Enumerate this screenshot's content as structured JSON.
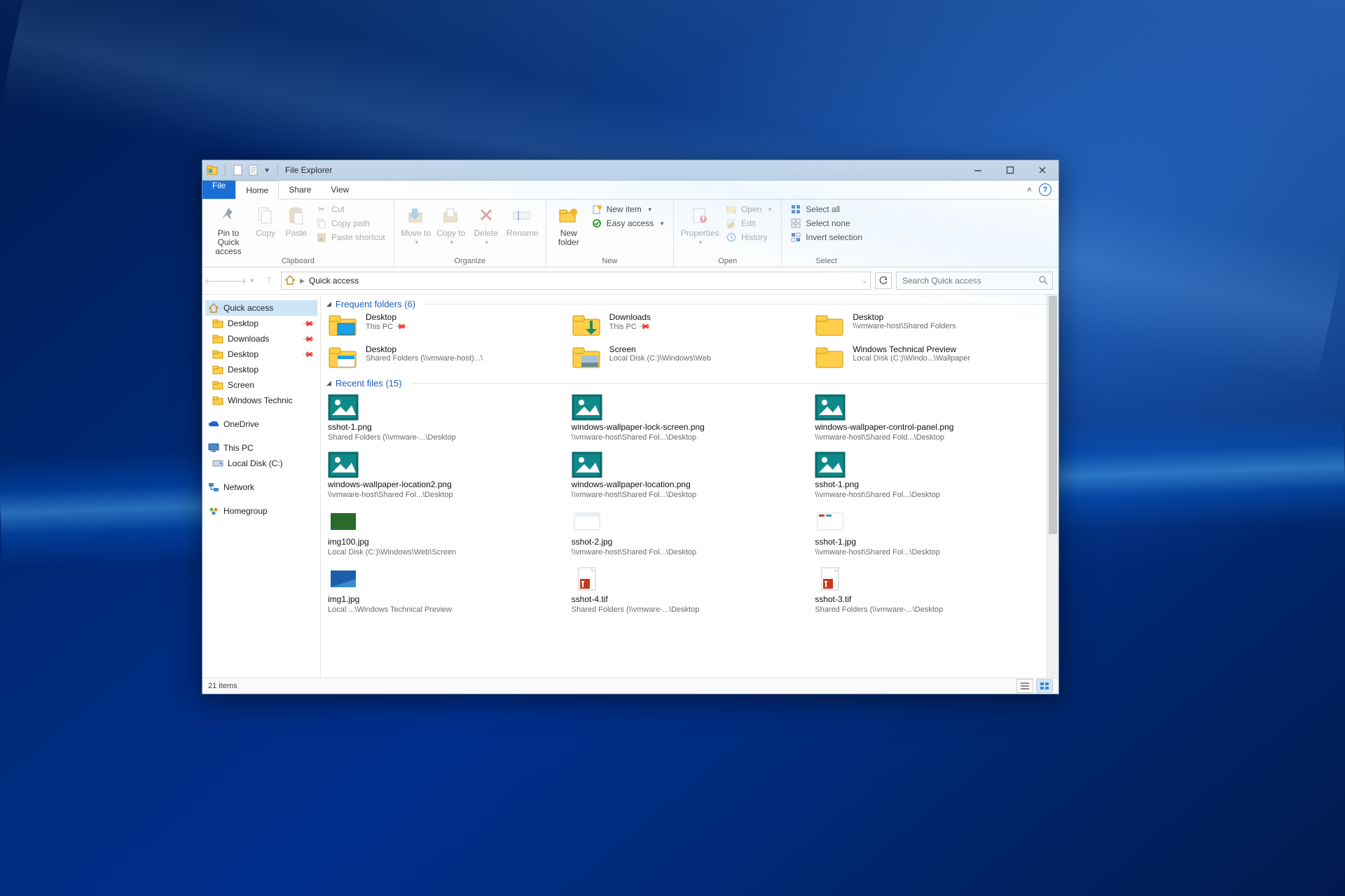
{
  "window": {
    "title": "File Explorer"
  },
  "tabs": {
    "file": "File",
    "home": "Home",
    "share": "Share",
    "view": "View"
  },
  "ribbon": {
    "clipboard": {
      "label": "Clipboard",
      "pin": "Pin to Quick access",
      "copy": "Copy",
      "paste": "Paste",
      "cut": "Cut",
      "copy_path": "Copy path",
      "paste_shortcut": "Paste shortcut"
    },
    "organize": {
      "label": "Organize",
      "move_to": "Move to",
      "copy_to": "Copy to",
      "delete": "Delete",
      "rename": "Rename"
    },
    "new": {
      "label": "New",
      "new_folder": "New folder",
      "new_item": "New item",
      "easy_access": "Easy access"
    },
    "open": {
      "label": "Open",
      "properties": "Properties",
      "open": "Open",
      "edit": "Edit",
      "history": "History"
    },
    "select": {
      "label": "Select",
      "select_all": "Select all",
      "select_none": "Select none",
      "invert": "Invert selection"
    }
  },
  "address": {
    "location": "Quick access"
  },
  "search": {
    "placeholder": "Search Quick access"
  },
  "sidebar": {
    "quick_access": "Quick access",
    "items": [
      {
        "label": "Desktop",
        "pinned": true
      },
      {
        "label": "Downloads",
        "pinned": true
      },
      {
        "label": "Desktop",
        "pinned": true
      },
      {
        "label": "Desktop",
        "pinned": false
      },
      {
        "label": "Screen",
        "pinned": false
      },
      {
        "label": "Windows Technic",
        "pinned": false
      }
    ],
    "onedrive": "OneDrive",
    "this_pc": "This PC",
    "local_disk": "Local Disk (C:)",
    "network": "Network",
    "homegroup": "Homegroup"
  },
  "sections": {
    "frequent": "Frequent folders (6)",
    "recent": "Recent files (15)"
  },
  "frequent_folders": [
    {
      "name": "Desktop",
      "path": "This PC",
      "pinned": true,
      "variant": "desktop"
    },
    {
      "name": "Downloads",
      "path": "This PC",
      "pinned": true,
      "variant": "downloads"
    },
    {
      "name": "Desktop",
      "path": "\\\\vmware-host\\Shared Folders",
      "pinned": false,
      "variant": "plain"
    },
    {
      "name": "Desktop",
      "path": "Shared Folders (\\\\vmware-host)...\\",
      "pinned": false,
      "variant": "desktop2"
    },
    {
      "name": "Screen",
      "path": "Local Disk (C:)\\Windows\\Web",
      "pinned": false,
      "variant": "screen"
    },
    {
      "name": "Windows Technical Preview",
      "path": "Local Disk (C:)\\Windo...\\Wallpaper",
      "pinned": false,
      "variant": "plain"
    }
  ],
  "recent_files": [
    {
      "name": "sshot-1.png",
      "path": "Shared Folders (\\\\vmware-...\\Desktop",
      "thumb": "png"
    },
    {
      "name": "windows-wallpaper-lock-screen.png",
      "path": "\\\\vmware-host\\Shared Fol...\\Desktop",
      "thumb": "png"
    },
    {
      "name": "windows-wallpaper-control-panel.png",
      "path": "\\\\vmware-host\\Shared Fold...\\Desktop",
      "thumb": "png"
    },
    {
      "name": "windows-wallpaper-location2.png",
      "path": "\\\\vmware-host\\Shared Fol...\\Desktop",
      "thumb": "png"
    },
    {
      "name": "windows-wallpaper-location.png",
      "path": "\\\\vmware-host\\Shared Fol...\\Desktop",
      "thumb": "png"
    },
    {
      "name": "sshot-1.png",
      "path": "\\\\vmware-host\\Shared Fol...\\Desktop",
      "thumb": "png"
    },
    {
      "name": "img100.jpg",
      "path": "Local Disk (C:)\\Windows\\Web\\Screen",
      "thumb": "green"
    },
    {
      "name": "sshot-2.jpg",
      "path": "\\\\vmware-host\\Shared Fol...\\Desktop",
      "thumb": "white"
    },
    {
      "name": "sshot-1.jpg",
      "path": "\\\\vmware-host\\Shared Fol...\\Desktop",
      "thumb": "white2"
    },
    {
      "name": "img1.jpg",
      "path": "Local ...\\Windows Technical Preview",
      "thumb": "blue"
    },
    {
      "name": "sshot-4.tif",
      "path": "Shared Folders (\\\\vmware-...\\Desktop",
      "thumb": "tif"
    },
    {
      "name": "sshot-3.tif",
      "path": "Shared Folders (\\\\vmware-...\\Desktop",
      "thumb": "tif"
    }
  ],
  "status": {
    "items": "21 items"
  }
}
